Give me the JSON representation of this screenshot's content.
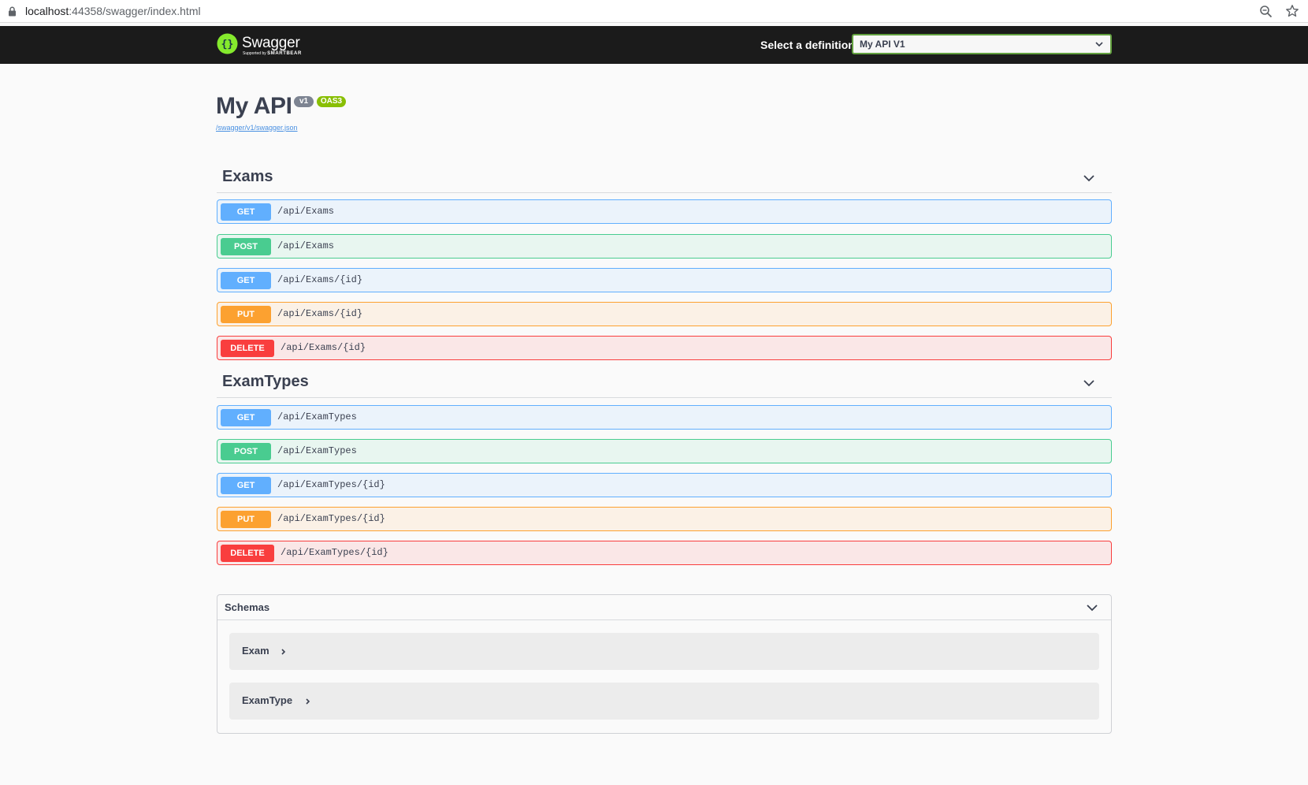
{
  "browser": {
    "url_host": "localhost",
    "url_path": ":44358/swagger/index.html",
    "icons": [
      "lock-icon",
      "zoom-icon",
      "star-icon"
    ]
  },
  "topbar": {
    "logo_text": "Swagger",
    "logo_sub_prefix": "Supported by ",
    "logo_sub_brand": "SMARTBEAR",
    "definition_label": "Select a definition",
    "definition_value": "My API V1",
    "colors": {
      "background": "#1b1b1b",
      "accent": "#85ea2d",
      "select_border": "#62a03f"
    }
  },
  "info": {
    "title": "My API",
    "version_badge": "v1",
    "oas_badge": "OAS3",
    "spec_url": "/swagger/v1/swagger.json"
  },
  "tags": [
    {
      "name": "Exams",
      "operations": [
        {
          "method": "GET",
          "path": "/api/Exams"
        },
        {
          "method": "POST",
          "path": "/api/Exams"
        },
        {
          "method": "GET",
          "path": "/api/Exams/{id}"
        },
        {
          "method": "PUT",
          "path": "/api/Exams/{id}"
        },
        {
          "method": "DELETE",
          "path": "/api/Exams/{id}"
        }
      ]
    },
    {
      "name": "ExamTypes",
      "operations": [
        {
          "method": "GET",
          "path": "/api/ExamTypes"
        },
        {
          "method": "POST",
          "path": "/api/ExamTypes"
        },
        {
          "method": "GET",
          "path": "/api/ExamTypes/{id}"
        },
        {
          "method": "PUT",
          "path": "/api/ExamTypes/{id}"
        },
        {
          "method": "DELETE",
          "path": "/api/ExamTypes/{id}"
        }
      ]
    }
  ],
  "schemas": {
    "title": "Schemas",
    "models": [
      {
        "name": "Exam"
      },
      {
        "name": "ExamType"
      }
    ]
  },
  "method_colors": {
    "GET": "#61affe",
    "POST": "#49cc90",
    "PUT": "#fca130",
    "DELETE": "#f93e3e"
  }
}
